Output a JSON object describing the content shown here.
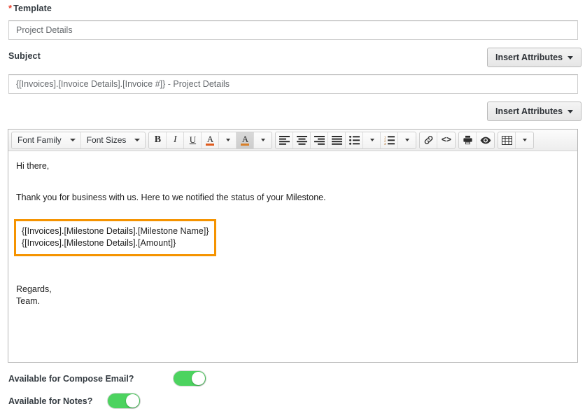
{
  "form": {
    "template": {
      "label": "Template",
      "required_marker": "*",
      "value": "Project Details"
    },
    "subject": {
      "label": "Subject",
      "value": "{[Invoices].[Invoice Details].[Invoice #]}  - Project Details"
    },
    "insert_attributes_top": "Insert Attributes",
    "insert_attributes_bottom": "Insert Attributes"
  },
  "editor": {
    "toolbar": {
      "font_family": "Font Family",
      "font_sizes": "Font Sizes",
      "bold": "B",
      "italic": "I",
      "underline": "U",
      "text_color": "A",
      "background_color": "A",
      "align_left": "align-left-icon",
      "align_center": "align-center-icon",
      "align_right": "align-right-icon",
      "align_justify": "align-justify-icon",
      "bullet_list": "bullet-list-icon",
      "numbered_list": "numbered-list-icon",
      "insert_link": "link-icon",
      "source_code": "<>",
      "print": "printer-icon",
      "preview": "eye-icon",
      "table": "table-icon"
    },
    "content": {
      "greeting": "Hi there,",
      "thanks": "Thank you for business with us. Here to we notified the status of your Milestone.",
      "placeholder_line_1": "{[Invoices].[Milestone Details].[Milestone Name]}",
      "placeholder_line_2": "{[Invoices].[Milestone Details].[Amount]}",
      "signoff_line_1": "Regards,",
      "signoff_line_2": "Team."
    },
    "highlight_color": "#f59300"
  },
  "toggles": [
    {
      "label": "Available for Compose Email?",
      "state": "on"
    },
    {
      "label": "Available for Notes?",
      "state": "on"
    }
  ],
  "colors": {
    "required": "#e8422e",
    "toggle_on": "#4cd35f",
    "highlight_border": "#f59300"
  }
}
